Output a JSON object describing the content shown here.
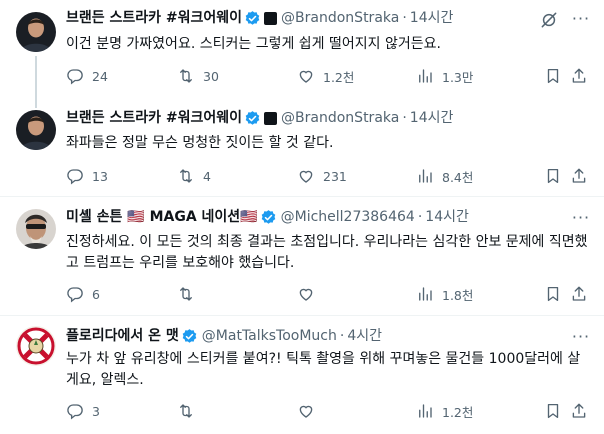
{
  "tweets": [
    {
      "name": "브랜든 스트라카 #워크어웨이",
      "handle": "@BrandonStraka",
      "time": "14시간",
      "text": "이건 분명 가짜였어요. 스티커는 그렇게 쉽게 떨어지지 않거든요.",
      "replies": "24",
      "reposts": "30",
      "likes": "1.2천",
      "views": "1.3만"
    },
    {
      "name": "브랜든 스트라카 #워크어웨이",
      "handle": "@BrandonStraka",
      "time": "14시간",
      "text": "좌파들은 정말 무슨 멍청한 짓이든 할 것 같다.",
      "replies": "13",
      "reposts": "4",
      "likes": "231",
      "views": "8.4천"
    },
    {
      "name": "미셸 손튼 🇺🇸 MAGA 네이션🇺🇸",
      "handle": "@Michell27386464",
      "time": "14시간",
      "text": "진정하세요. 이 모든 것의 최종 결과는 초점입니다. 우리나라는 심각한 안보 문제에 직면했고 트럼프는 우리를 보호해야 했습니다.",
      "replies": "6",
      "reposts": "",
      "likes": "",
      "views": "1.8천"
    },
    {
      "name": "플로리다에서 온 맷",
      "handle": "@MatTalksTooMuch",
      "time": "4시간",
      "text": "누가 차 앞 유리창에 스티커를 붙여?! 틱톡 촬영을 위해 꾸며놓은 물건들 1000달러에 살게요, 알렉스.",
      "replies": "3",
      "reposts": "",
      "likes": "",
      "views": "1.2천"
    }
  ],
  "separator": "·",
  "more_glyph": "···",
  "colors": {
    "verified": "#1d9bf0",
    "secondary_text": "#536471",
    "divider": "#eff3f4"
  },
  "icons": {
    "reply": "reply-icon",
    "repost": "repost-icon",
    "like": "like-icon",
    "views": "views-icon",
    "bookmark": "bookmark-icon",
    "share": "share-icon",
    "grok": "grok-icon",
    "verified": "verified-badge-icon",
    "more": "more-icon"
  }
}
